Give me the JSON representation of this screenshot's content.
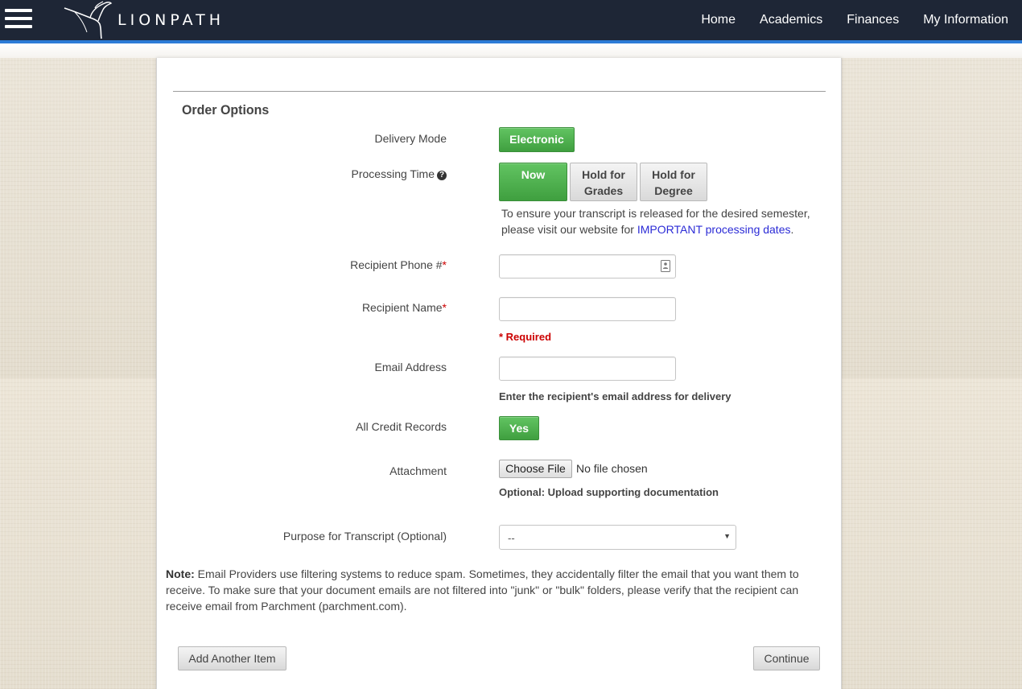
{
  "header": {
    "brand": "LIONPATH",
    "nav": [
      {
        "label": "Home"
      },
      {
        "label": "Academics"
      },
      {
        "label": "Finances"
      },
      {
        "label": "My Information"
      }
    ]
  },
  "section": {
    "title": "Order Options"
  },
  "form": {
    "delivery_mode": {
      "label": "Delivery Mode",
      "selected": "Electronic"
    },
    "processing_time": {
      "label": "Processing Time",
      "options": [
        {
          "line1": "Now",
          "line2": ""
        },
        {
          "line1": "Hold for",
          "line2": "Grades"
        },
        {
          "line1": "Hold for",
          "line2": "Degree"
        }
      ],
      "selected": "Now",
      "info_text": "To ensure your transcript is released for the desired semester, please visit our website for",
      "info_link": "IMPORTANT processing dates",
      "info_end": "."
    },
    "recipient_phone": {
      "label": "Recipient Phone #",
      "required_mark": "*",
      "value": ""
    },
    "recipient_name": {
      "label": "Recipient Name",
      "required_mark": "*",
      "value": ""
    },
    "required_note": "* Required",
    "email": {
      "label": "Email Address",
      "value": "",
      "help": "Enter the recipient's email address for delivery"
    },
    "credit_records": {
      "label": "All Credit Records",
      "selected": "Yes"
    },
    "attachment": {
      "label": "Attachment",
      "button": "Choose File",
      "status": "No file chosen",
      "help": "Optional: Upload supporting documentation"
    },
    "purpose": {
      "label": "Purpose for Transcript (Optional)",
      "selected": "--"
    }
  },
  "note": {
    "prefix": "Note:",
    "text": "Email Providers use filtering systems to reduce spam. Sometimes, they accidentally filter the email that you want them to receive. To make sure that your document emails are not filtered into \"junk\" or \"bulk\" folders, please verify that the recipient can receive email from Parchment (parchment.com)."
  },
  "actions": {
    "add_another": "Add Another Item",
    "continue": "Continue"
  },
  "colors": {
    "header_bg": "#1e2636",
    "header_accent": "#2c7bd6",
    "selected_green": "#4cae4c",
    "required_red": "#cc0000",
    "link_blue": "#2b2bd6"
  },
  "icons": [
    "hamburger-menu-icon",
    "lion-logo-icon",
    "question-circle-icon",
    "phone-book-icon",
    "caret-down-icon"
  ]
}
